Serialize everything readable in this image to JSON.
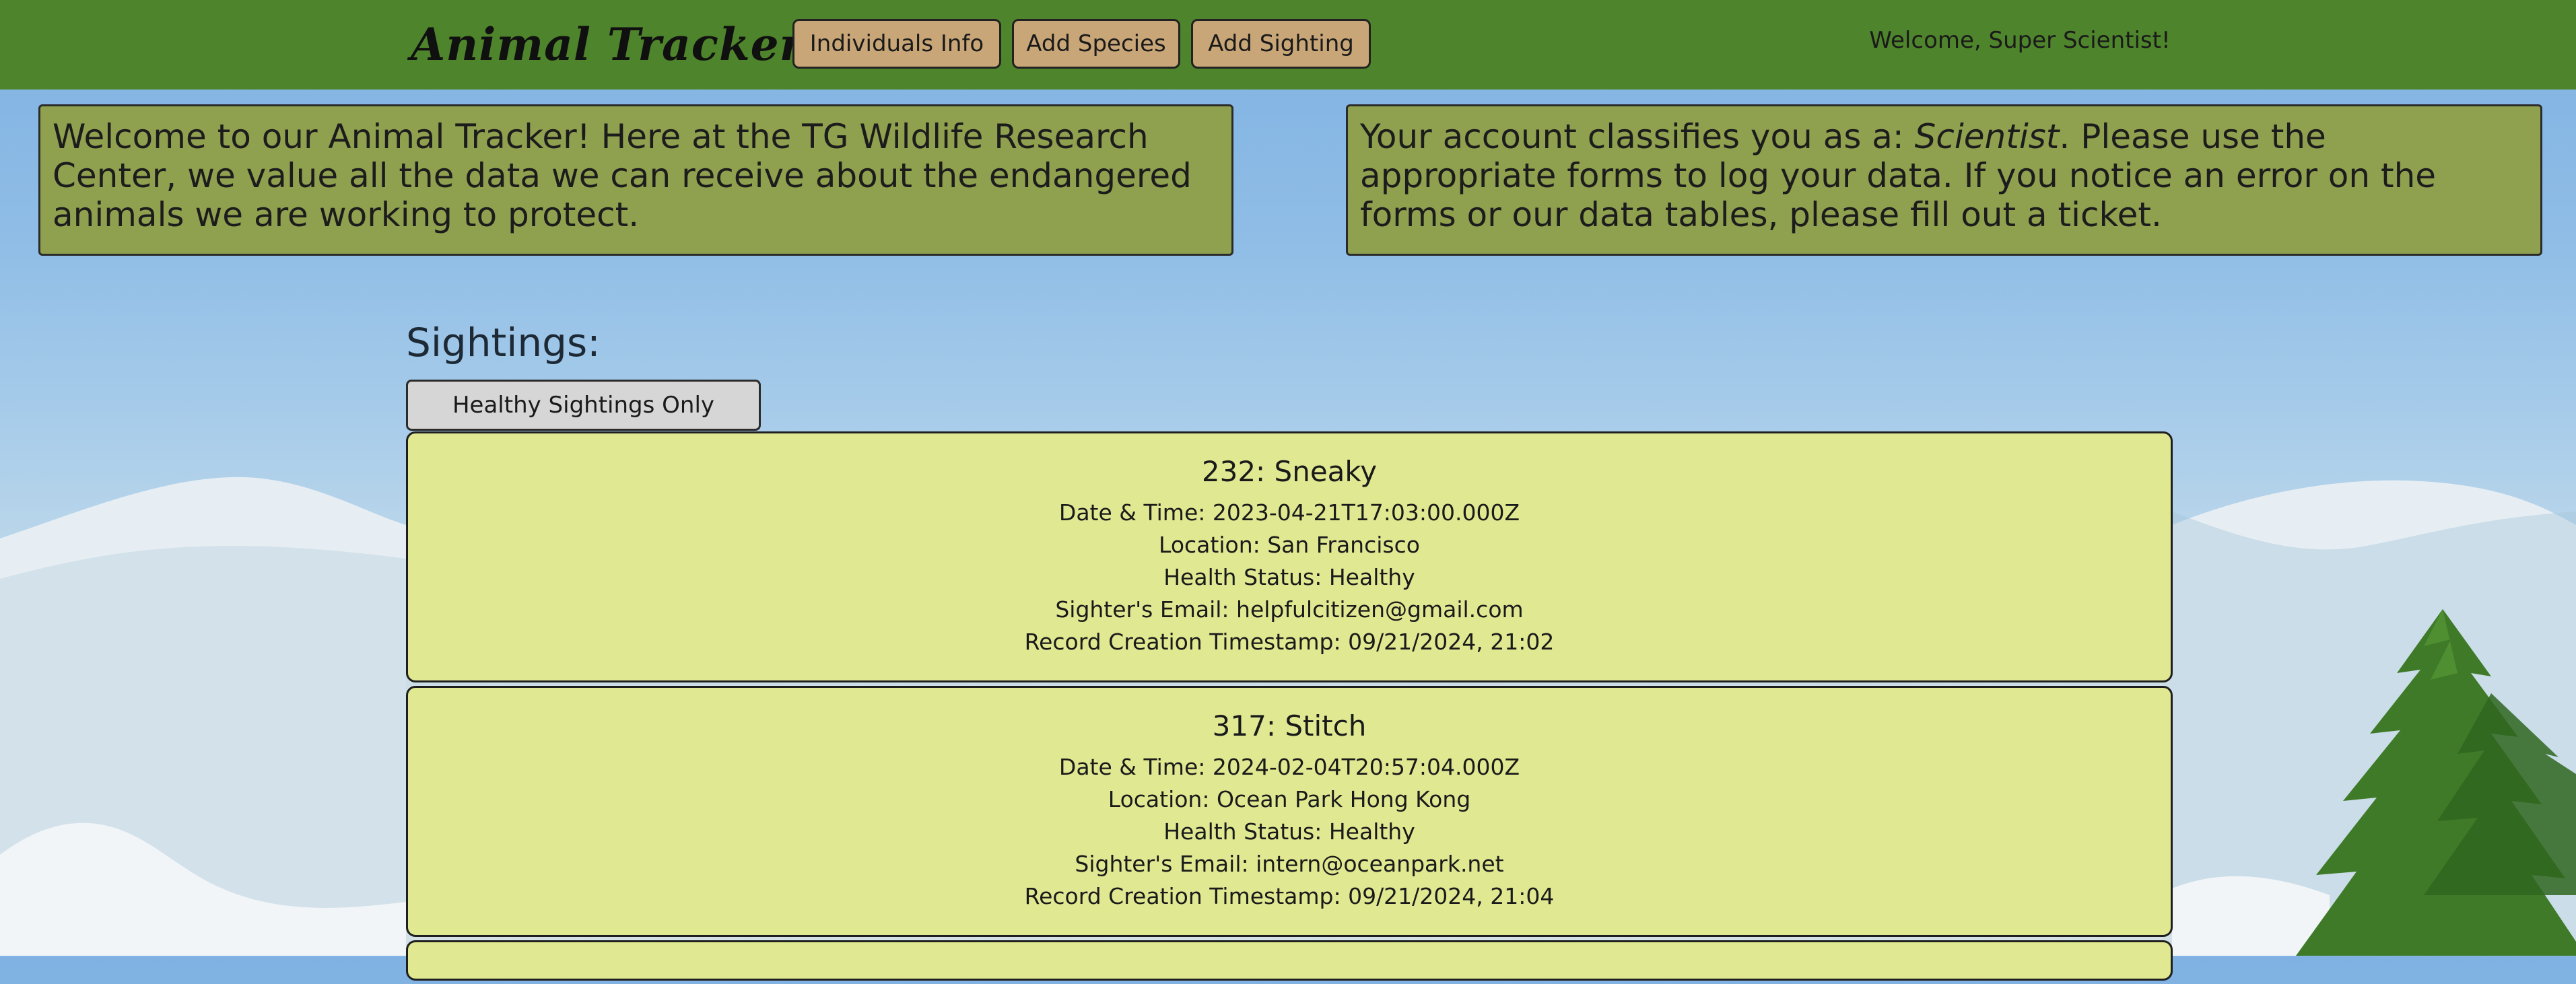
{
  "header": {
    "brand": "Animal Tracker",
    "nav": [
      {
        "label": "Individuals Info"
      },
      {
        "label": "Add Species"
      },
      {
        "label": "Add Sighting"
      }
    ],
    "welcome": "Welcome, Super Scientist!"
  },
  "intro": {
    "text": "Welcome to our Animal Tracker! Here at the TG Wildlife Research Center, we value all the data we can receive about the endangered animals we are working to protect."
  },
  "account": {
    "prefix": "Your account classifies you as a: ",
    "role": "Scientist",
    "suffix": ". Please use the appropriate forms to log your data. If you notice an error on the forms or our data tables, please fill out a ticket."
  },
  "sightings": {
    "heading": "Sightings:",
    "filter_label": "Healthy Sightings Only",
    "items": [
      {
        "title": "232: Sneaky",
        "datetime": "Date & Time: 2023-04-21T17:03:00.000Z",
        "location": "Location: San Francisco",
        "health": "Health Status: Healthy",
        "email": "Sighter's Email: helpfulcitizen@gmail.com",
        "created": "Record Creation Timestamp: 09/21/2024, 21:02"
      },
      {
        "title": "317: Stitch",
        "datetime": "Date & Time: 2024-02-04T20:57:04.000Z",
        "location": "Location: Ocean Park Hong Kong",
        "health": "Health Status: Healthy",
        "email": "Sighter's Email: intern@oceanpark.net",
        "created": "Record Creation Timestamp: 09/21/2024, 21:04"
      }
    ]
  },
  "colors": {
    "header_bg": "#4e842b",
    "nav_button_bg": "#c8a677",
    "info_panel_bg": "#8fa04f",
    "card_bg": "#e0e892",
    "filter_button_bg": "#d6d6d6"
  },
  "icons": {
    "brand_icon": "magnifying-glass-icon"
  }
}
